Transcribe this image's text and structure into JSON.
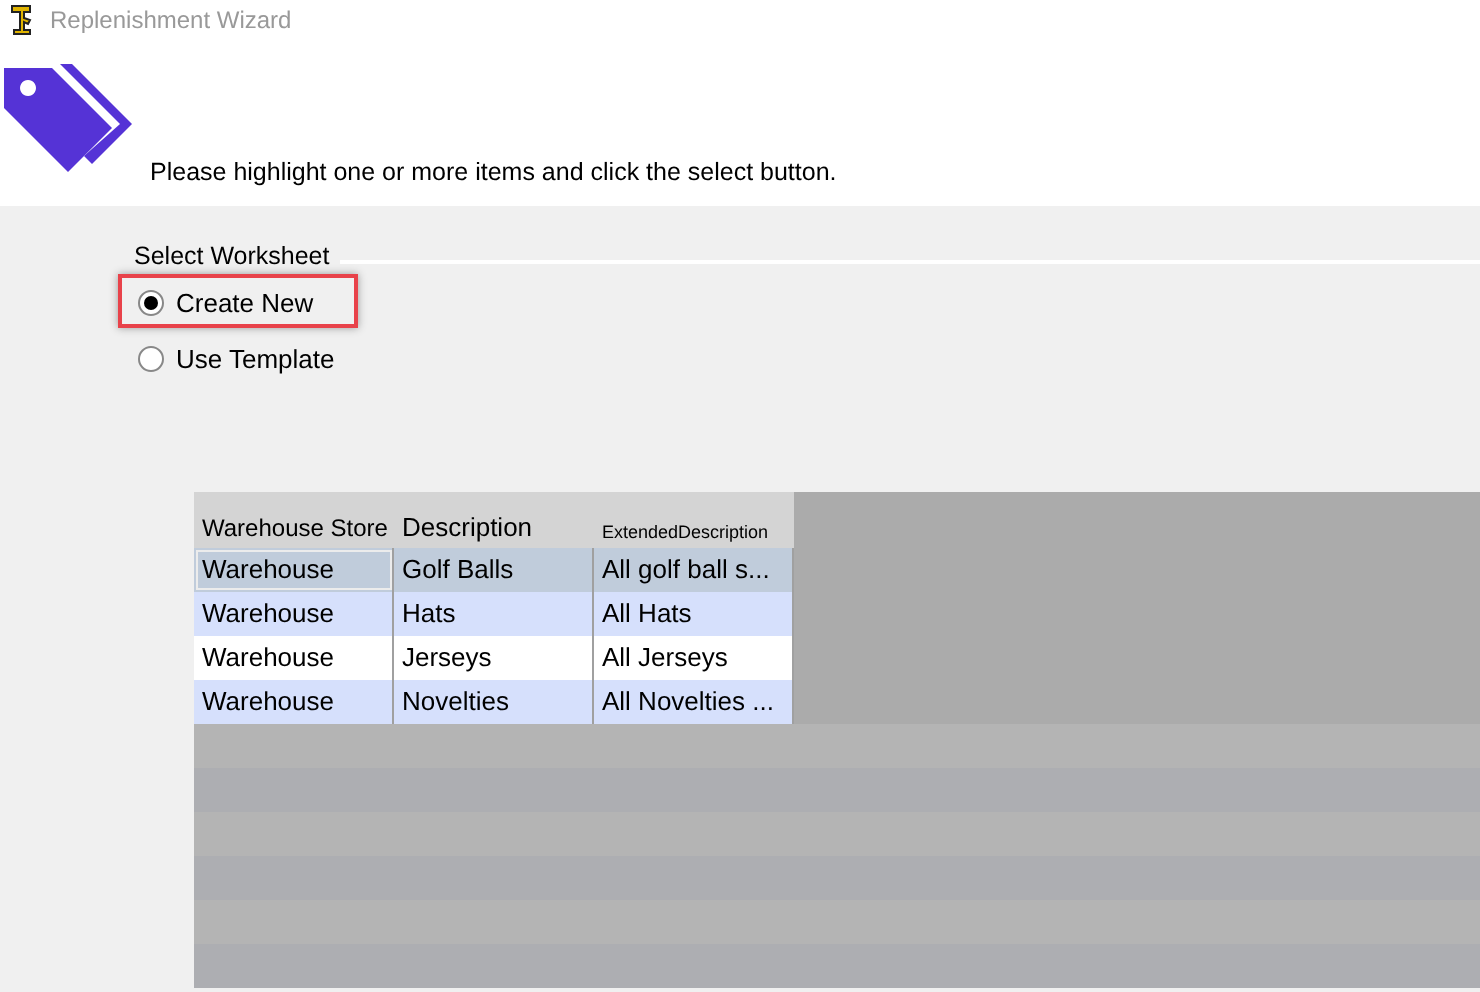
{
  "window": {
    "title": "Replenishment Wizard"
  },
  "instruction": "Please highlight one or more items and click the select button.",
  "worksheet": {
    "label": "Select Worksheet",
    "options": [
      {
        "label": "Create New",
        "selected": true,
        "highlighted": true
      },
      {
        "label": "Use Template",
        "selected": false,
        "highlighted": false
      }
    ]
  },
  "table": {
    "columns": [
      "Warehouse Store",
      "Description",
      "ExtendedDescription"
    ],
    "rows": [
      {
        "cells": [
          "Warehouse",
          "Golf Balls",
          "All golf ball s..."
        ],
        "selected": true
      },
      {
        "cells": [
          "Warehouse",
          "Hats",
          "All Hats"
        ],
        "selected": false
      },
      {
        "cells": [
          "Warehouse",
          "Jerseys",
          "All Jerseys"
        ],
        "selected": false
      },
      {
        "cells": [
          "Warehouse",
          "Novelties",
          "All Novelties ..."
        ],
        "selected": false
      }
    ]
  }
}
